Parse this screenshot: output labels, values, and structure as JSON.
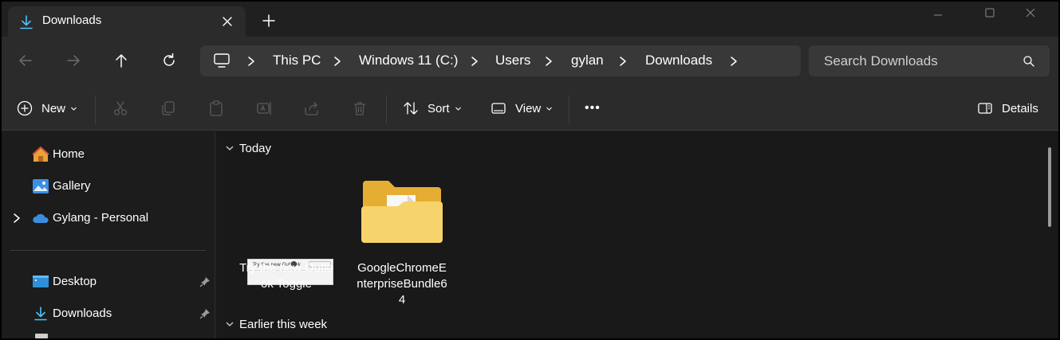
{
  "window": {
    "tab_title": "Downloads",
    "tab_icon": "download-icon",
    "controls": [
      "minimize-icon",
      "maximize-icon",
      "close-icon"
    ]
  },
  "address": {
    "root_icon": "computer-icon",
    "breadcrumbs": [
      "This PC",
      "Windows 11 (C:)",
      "Users",
      "gylan",
      "Downloads"
    ]
  },
  "search": {
    "placeholder": "Search Downloads"
  },
  "commands": {
    "new_label": "New",
    "sort_label": "Sort",
    "view_label": "View",
    "details_label": "Details",
    "more_label": "•••"
  },
  "sidebar": {
    "items": [
      {
        "label": "Home",
        "icon": "home-icon"
      },
      {
        "label": "Gallery",
        "icon": "gallery-icon"
      },
      {
        "label": "Gylang - Personal",
        "icon": "onedrive-cloud-icon"
      }
    ],
    "quick_access": [
      {
        "label": "Desktop",
        "icon": "desktop-folder-icon",
        "pinned": true
      },
      {
        "label": "Downloads",
        "icon": "download-icon",
        "pinned": true
      }
    ]
  },
  "content": {
    "groups": [
      {
        "header": "Today",
        "files": [
          {
            "name": "Try the new Outlook Toggle",
            "type": "image",
            "thumb_text": "Try the new Outlook"
          },
          {
            "name": "GoogleChromeEnterpriseBundle64",
            "type": "folder"
          }
        ]
      },
      {
        "header": "Earlier this week",
        "files": []
      }
    ]
  },
  "colors": {
    "accent": "#4cc2ff",
    "folder": "#f4c84a",
    "window_bg": "#1c1c1c",
    "bar_bg": "#2b2b2b"
  }
}
